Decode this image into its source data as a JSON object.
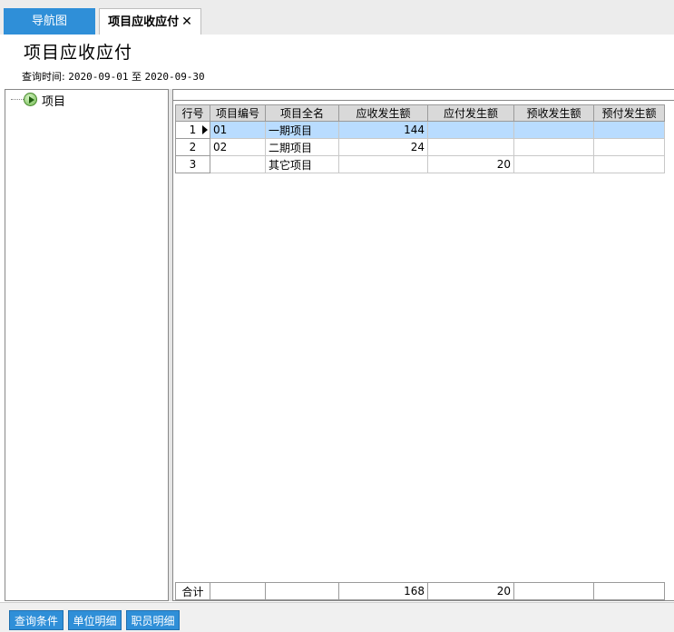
{
  "tabs": {
    "nav_label": "导航图",
    "active_label": "项目应收应付",
    "close_glyph": "✕"
  },
  "page": {
    "title": "项目应收应付",
    "query_label": "查询时间:",
    "date_from": "2020-09-01",
    "to_word": "至",
    "date_to": "2020-09-30"
  },
  "tree": {
    "root_label": "项目"
  },
  "grid": {
    "columns": [
      "行号",
      "项目编号",
      "项目全名",
      "应收发生额",
      "应付发生额",
      "预收发生额",
      "预付发生额"
    ],
    "rows": [
      {
        "rownum": "1",
        "code": "01",
        "name": "一期项目",
        "receivable": "144",
        "payable": "",
        "prereceived": "",
        "prepaid": ""
      },
      {
        "rownum": "2",
        "code": "02",
        "name": "二期项目",
        "receivable": "24",
        "payable": "",
        "prereceived": "",
        "prepaid": ""
      },
      {
        "rownum": "3",
        "code": "",
        "name": "其它项目",
        "receivable": "",
        "payable": "20",
        "prereceived": "",
        "prepaid": ""
      }
    ],
    "selected_row": 1,
    "totals": {
      "label": "合计",
      "code": "",
      "name": "",
      "receivable": "168",
      "payable": "20",
      "prereceived": "",
      "prepaid": ""
    }
  },
  "buttons": {
    "query_conditions": "查询条件",
    "unit_detail": "单位明细",
    "staff_detail": "职员明细"
  },
  "colors": {
    "accent": "#2f8fd8",
    "selected_row": "#b9dcff"
  }
}
